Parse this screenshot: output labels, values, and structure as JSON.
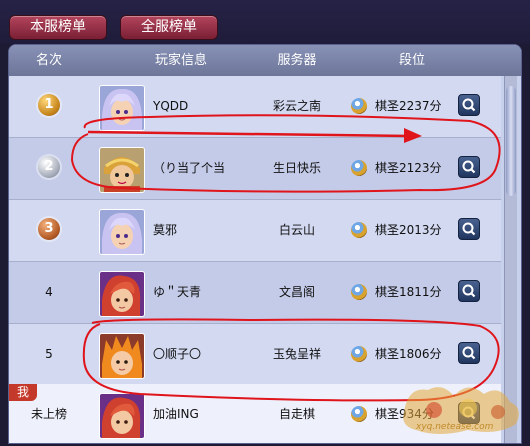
{
  "tabs": [
    {
      "label": "本服榜单"
    },
    {
      "label": "全服榜单"
    }
  ],
  "header": {
    "rank": "名次",
    "player": "玩家信息",
    "server": "服务器",
    "grade": "段位"
  },
  "rows": [
    {
      "rank": "1",
      "name": "YQDD",
      "server": "彩云之南",
      "score": "棋圣2237分",
      "avatar": "lavender-hair-avatar"
    },
    {
      "rank": "2",
      "name": "（り当了个当",
      "server": "生日快乐",
      "score": "棋圣2123分",
      "avatar": "monkey-king-avatar"
    },
    {
      "rank": "3",
      "name": "莫邪",
      "server": "白云山",
      "score": "棋圣2013分",
      "avatar": "lavender-hair-avatar"
    },
    {
      "rank": "4",
      "name": "ゆ＂天青",
      "server": "文昌阁",
      "score": "棋圣1811分",
      "avatar": "red-hair-avatar"
    },
    {
      "rank": "5",
      "name": "〇顺子〇",
      "server": "玉兔呈祥",
      "score": "棋圣1806分",
      "avatar": "flame-hair-avatar"
    }
  ],
  "me": {
    "badge": "我",
    "rank": "未上榜",
    "name": "加油ING",
    "server": "自走棋",
    "score": "棋圣934分"
  },
  "watermark": {
    "text": "xyq.netease.com"
  },
  "colors": {
    "tab_bg": "#9b2f47",
    "header_bg": "#7b84a8",
    "annotation": "#e0141b"
  }
}
